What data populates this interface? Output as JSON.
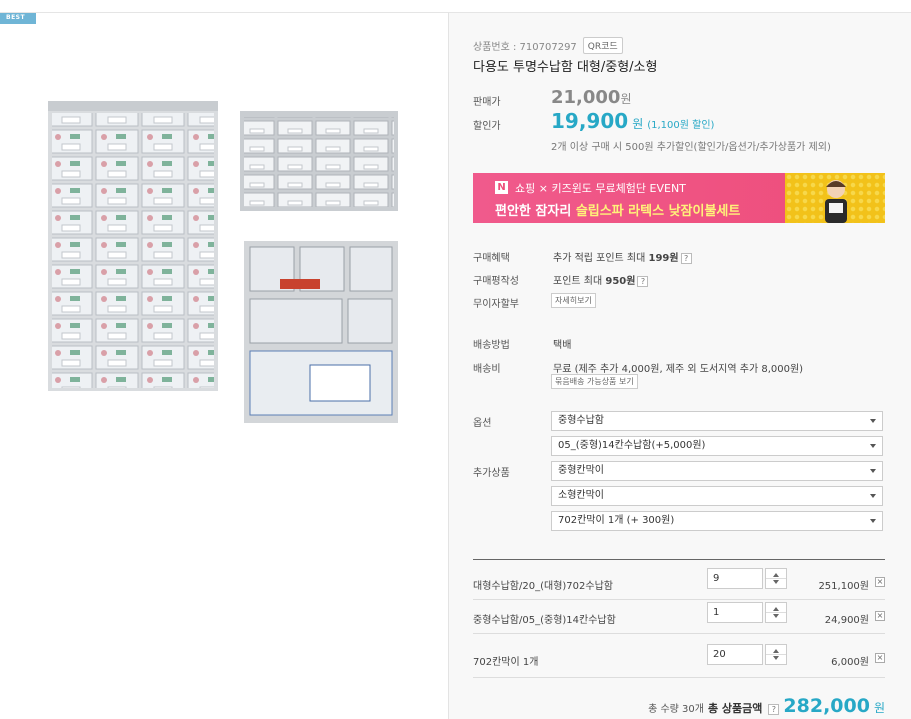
{
  "badge": "BEST",
  "product": {
    "number_label": "상품번호 : 710707297",
    "qr_label": "QR코드",
    "name": "다용도 투명수납함 대형/중형/소형"
  },
  "price": {
    "sale_label": "판매가",
    "original": "21,000",
    "won": "원",
    "discount_label": "할인가",
    "discounted": "19,900",
    "discount_note": "(1,100원 할인)",
    "multi_note": "2개 이상 구매 시 500원 추가할인(할인가/옵션가/추가상품가 제외)"
  },
  "banner": {
    "logo": "N",
    "line1": "쇼핑 × 키즈윈도 무료체험단 EVENT",
    "line2_prefix": "편안한 잠자리 ",
    "line2_highlight": "슬립스파 라텍스 낮잠이불세트"
  },
  "benefits": {
    "purchase_label": "구매혜택",
    "purchase_text": "추가 적립 포인트 최대 ",
    "purchase_value": "199원",
    "review_label": "구매평작성",
    "review_text": "포인트 최대 ",
    "review_value": "950원",
    "installment_label": "무이자할부",
    "installment_button": "자세히보기",
    "help": "?"
  },
  "shipping": {
    "method_label": "배송방법",
    "method": "택배",
    "fee_label": "배송비",
    "fee": "무료 (제주 추가 4,000원, 제주 외 도서지역 추가 8,000원)",
    "bundle_button": "묶음배송 가능상품 보기"
  },
  "options": {
    "option_label": "옵션",
    "addon_label": "추가상품",
    "selects": [
      "중형수납함",
      "05_(중형)14칸수납함(+5,000원)",
      "중형칸막이",
      "소형칸막이",
      "702칸막이 1개 (+ 300원)"
    ]
  },
  "cart": [
    {
      "name": "대형수납함/20_(대형)702수납함",
      "qty": "9",
      "price": "251,100원"
    },
    {
      "name": "중형수납함/05_(중형)14칸수납함",
      "qty": "1",
      "price": "24,900원"
    },
    {
      "name": "702칸막이 1개",
      "qty": "20",
      "price": "6,000원"
    }
  ],
  "total": {
    "count_text": "총 수량 30개",
    "label": "총 상품금액",
    "help": "?",
    "amount": "282,000",
    "won": "원"
  },
  "colors": {
    "accent": "#27a8c6",
    "banner": "#ee4d7a"
  }
}
